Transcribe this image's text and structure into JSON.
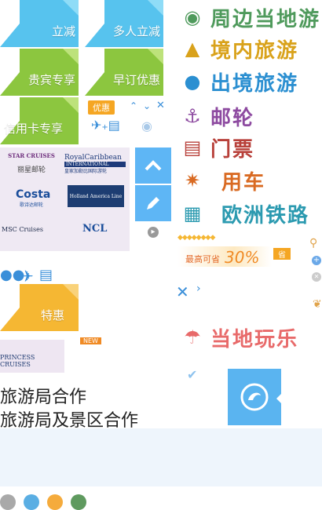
{
  "tiles": {
    "instant": "立减",
    "group": "多人立减",
    "vip": "贵宾专享",
    "early": "早订优惠",
    "credit": "信用卡专享",
    "special": "特惠"
  },
  "categories": [
    {
      "label": "周边当地游",
      "icon": "map-pin-icon",
      "color": "#4f9a5c"
    },
    {
      "label": "境内旅游",
      "icon": "china-map-icon",
      "color": "#d9a21b"
    },
    {
      "label": "出境旅游",
      "icon": "globe-plane-icon",
      "color": "#2b8fd1"
    },
    {
      "label": "邮轮",
      "icon": "cruise-ship-icon",
      "color": "#8d4aa0"
    },
    {
      "label": "门票",
      "icon": "ticket-icon",
      "color": "#b8403a"
    },
    {
      "label": "用车",
      "icon": "steering-wheel-icon",
      "color": "#d96a22"
    },
    {
      "label": "欧洲铁路",
      "icon": "city-skyline-icon",
      "color": "#2b9ab0"
    },
    {
      "label": "当地玩乐",
      "icon": "beach-umbrella-icon",
      "color": "#e86a6a"
    }
  ],
  "flags": {
    "discount": "优惠",
    "new": "NEW"
  },
  "brands": {
    "star_cruises": "STAR CRUISES",
    "star_cruises_cn": "丽星邮轮",
    "royal": "RoyalCaribbean",
    "royal_sub": "INTERNATIONAL",
    "royal_cn": "皇家加勒比国际游轮",
    "costa": "Costa",
    "costa_cn": "歌诗达邮轮",
    "holland": "Holland America Line",
    "msc": "MSC Cruises",
    "ncl": "NCL",
    "princess": "PRINCESS CRUISES"
  },
  "promo": {
    "prefix": "最高可省",
    "value": "30%",
    "badge": "省"
  },
  "text": {
    "line1": "旅游局合作",
    "line2": "旅游局及景区合作"
  },
  "dots": [
    "#a9a9a9",
    "#5aaee3",
    "#f5ab3c",
    "#5f9a5f"
  ],
  "colors": {
    "blue_tile": "#57c3ee",
    "green_tile": "#8cc63f",
    "orange_tile": "#f5b733",
    "button_blue": "#5eb6f5",
    "icon_blue": "#3a8fd9"
  }
}
